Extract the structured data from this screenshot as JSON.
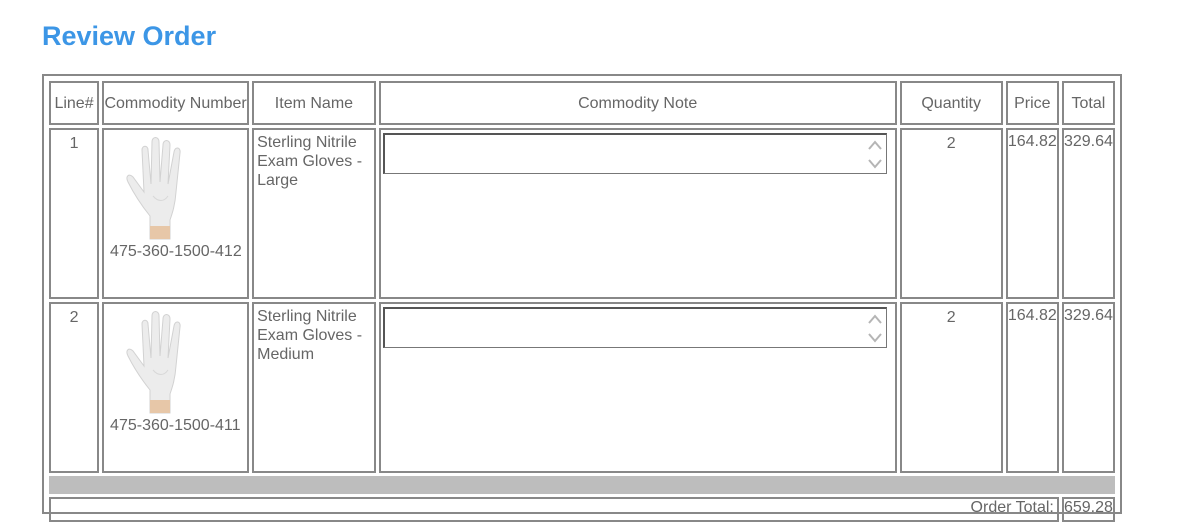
{
  "page": {
    "title": "Review Order"
  },
  "table": {
    "headers": {
      "line": "Line#",
      "commodity_number": "Commodity Number",
      "item_name": "Item Name",
      "commodity_note": "Commodity Note",
      "quantity": "Quantity",
      "price": "Price",
      "total": "Total"
    },
    "rows": [
      {
        "line": "1",
        "commodity_number": "475-360-1500-412",
        "item_name": "Sterling Nitrile Exam Gloves - Large",
        "note": "",
        "quantity": "2",
        "price": "164.82",
        "total": "329.64",
        "image_icon": "nitrile-glove-image"
      },
      {
        "line": "2",
        "commodity_number": "475-360-1500-411",
        "item_name": "Sterling Nitrile Exam Gloves - Medium",
        "note": "",
        "quantity": "2",
        "price": "164.82",
        "total": "329.64",
        "image_icon": "nitrile-glove-image"
      }
    ],
    "footer": {
      "order_total_label": "Order Total:",
      "order_total_value": "659.28"
    }
  },
  "colors": {
    "title": "#3c96e6",
    "border": "#888888",
    "text": "#666666",
    "spacer": "#bdbdbd"
  }
}
